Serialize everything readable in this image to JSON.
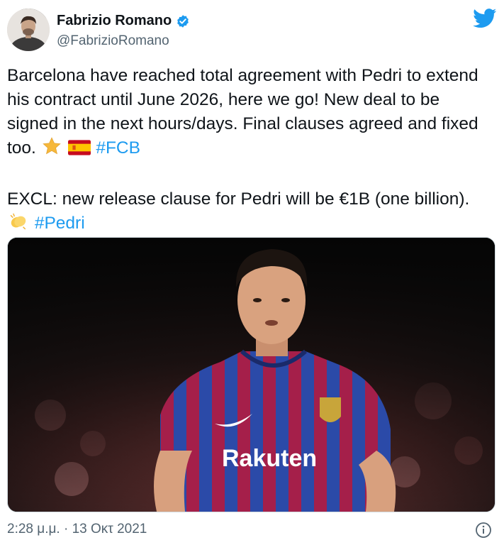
{
  "author": {
    "display_name": "Fabrizio Romano",
    "handle": "@FabrizioRomano",
    "verified": true
  },
  "tweet": {
    "paragraph1": {
      "text": "Barcelona have reached total agreement with Pedri to extend his contract until June 2026, here we go! New deal to be signed in the next hours/days. Final clauses agreed and fixed too.",
      "emojis": [
        "star-emoji",
        "spain-flag-emoji"
      ],
      "hashtag": "#FCB"
    },
    "paragraph2": {
      "text": "EXCL: new release clause for Pedri will be €1B (one billion).",
      "emojis": [
        "clapping-hands-emoji"
      ],
      "hashtag": "#Pedri"
    }
  },
  "media": {
    "description_icon": "player-photo",
    "shirt_sponsor": "Rakuten"
  },
  "footer": {
    "timestamp": "2:28 μ.μ. · 13 Οκτ 2021"
  },
  "icons": {
    "brand": "twitter-bird-icon",
    "info": "info-icon",
    "verified": "verified-badge-icon"
  },
  "colors": {
    "link": "#1d9bf0",
    "verified": "#1d9bf0",
    "twitter": "#1d9bf0",
    "muted": "#536471"
  }
}
